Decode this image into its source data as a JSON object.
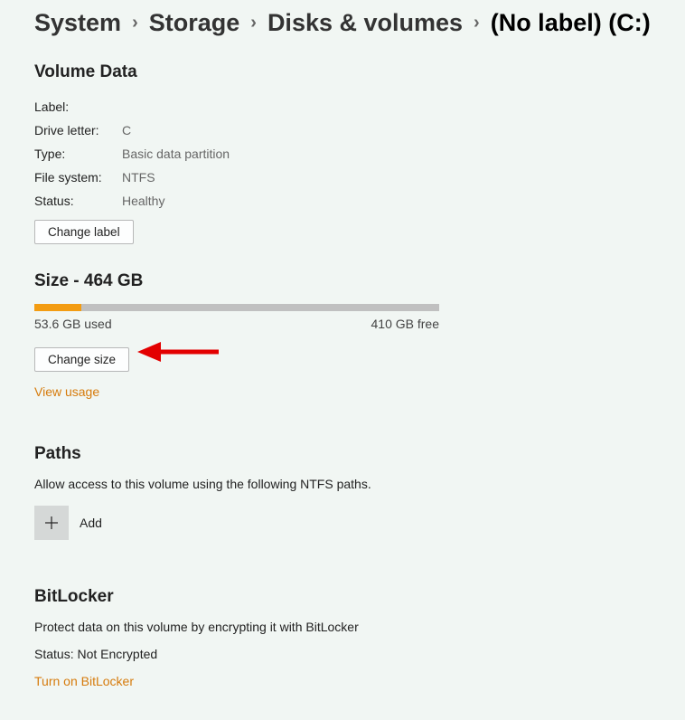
{
  "breadcrumb": {
    "items": [
      "System",
      "Storage",
      "Disks & volumes"
    ],
    "current": "(No label) (C:)"
  },
  "volume_data": {
    "title": "Volume Data",
    "rows": {
      "label_k": "Label:",
      "label_v": "",
      "drive_k": "Drive letter:",
      "drive_v": "C",
      "type_k": "Type:",
      "type_v": "Basic data partition",
      "fs_k": "File system:",
      "fs_v": "NTFS",
      "status_k": "Status:",
      "status_v": "Healthy"
    },
    "change_label_btn": "Change label"
  },
  "size": {
    "title": "Size - 464 GB",
    "used_label": "53.6 GB used",
    "free_label": "410 GB free",
    "used_gb": 53.6,
    "total_gb": 464,
    "change_size_btn": "Change size",
    "view_usage_link": "View usage"
  },
  "paths": {
    "title": "Paths",
    "desc": "Allow access to this volume using the following NTFS paths.",
    "add_label": "Add"
  },
  "bitlocker": {
    "title": "BitLocker",
    "desc": "Protect data on this volume by encrypting it with BitLocker",
    "status": "Status: Not Encrypted",
    "turn_on_link": "Turn on BitLocker"
  }
}
